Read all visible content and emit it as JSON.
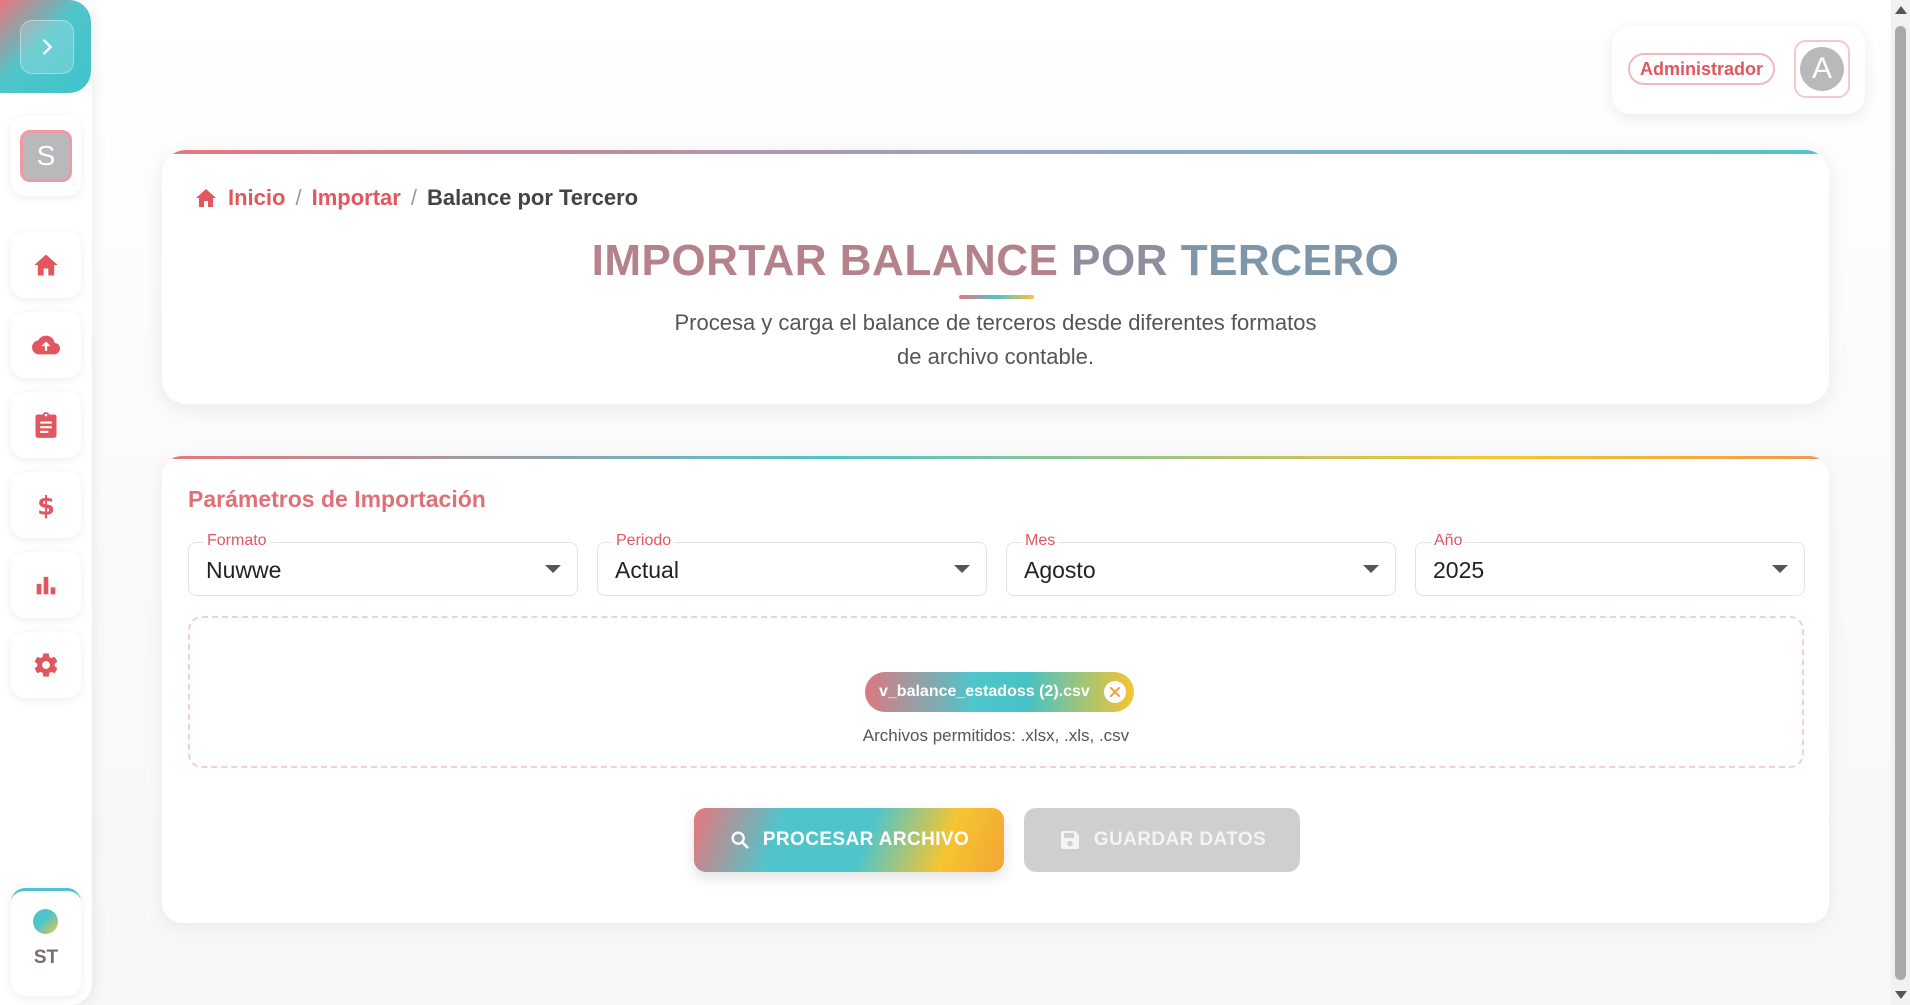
{
  "colors": {
    "accent": "#e2575f",
    "teal": "#4fc5cb",
    "yellow": "#f5c531",
    "disabled": "#cfcfcf"
  },
  "sidebar": {
    "toggle_icon": "chevron-right-icon",
    "avatar_initial": "S",
    "items": [
      {
        "name": "home",
        "icon": "home-icon"
      },
      {
        "name": "upload",
        "icon": "cloud-upload-icon"
      },
      {
        "name": "reports",
        "icon": "clipboard-icon"
      },
      {
        "name": "finance",
        "icon": "dollar-icon"
      },
      {
        "name": "charts",
        "icon": "bar-chart-icon"
      },
      {
        "name": "settings",
        "icon": "gear-icon"
      }
    ],
    "bottom_initials": "ST"
  },
  "user": {
    "role": "Administrador",
    "avatar_initial": "A"
  },
  "header": {
    "breadcrumb": {
      "home": "Inicio",
      "section": "Importar",
      "separator": "/",
      "current": "Balance por Tercero"
    },
    "title_part1": "IMPORTAR BALANCE",
    "title_part2": "POR",
    "title_part3": "TERCERO",
    "subtitle_line1": "Procesa y carga el balance de terceros desde diferentes formatos",
    "subtitle_line2": "de archivo contable."
  },
  "params": {
    "section_title": "Parámetros de Importación",
    "fields": [
      {
        "label": "Formato",
        "value": "Nuwwe"
      },
      {
        "label": "Periodo",
        "value": "Actual"
      },
      {
        "label": "Mes",
        "value": "Agosto"
      },
      {
        "label": "Año",
        "value": "2025"
      }
    ],
    "file_name": "v_balance_estadoss (2).csv",
    "allowed_text": "Archivos permitidos: .xlsx, .xls, .csv",
    "process_label": "PROCESAR ARCHIVO",
    "save_label": "GUARDAR DATOS"
  }
}
